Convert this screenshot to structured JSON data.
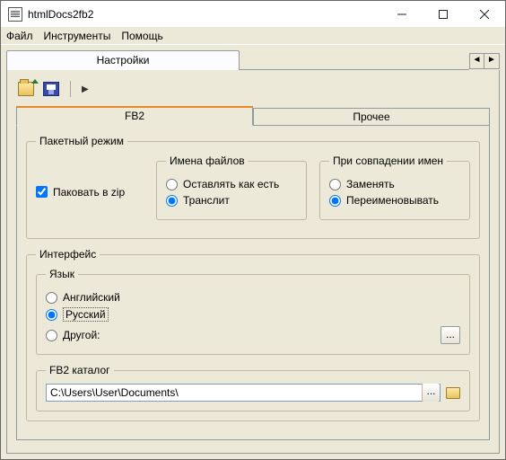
{
  "window": {
    "title": "htmlDocs2fb2"
  },
  "menu": {
    "file": "Файл",
    "tools": "Инструменты",
    "help": "Помощь"
  },
  "mainTab": "Настройки",
  "subTabs": {
    "fb2": "FB2",
    "other": "Прочее"
  },
  "batch": {
    "legend": "Пакетный режим",
    "packZip": "Паковать в zip",
    "packZipChecked": true,
    "filenames": {
      "legend": "Имена файлов",
      "keep": "Оставлять как есть",
      "translit": "Транслит",
      "selected": "translit"
    },
    "collision": {
      "legend": "При совпадении имен",
      "replace": "Заменять",
      "rename": "Переименовывать",
      "selected": "rename"
    }
  },
  "interface": {
    "legend": "Интерфейс",
    "language": {
      "legend": "Язык",
      "english": "Английский",
      "russian": "Русский",
      "other": "Другой:",
      "selected": "russian"
    },
    "catalog": {
      "legend": "FB2 каталог",
      "path": "C:\\Users\\User\\Documents\\"
    }
  }
}
